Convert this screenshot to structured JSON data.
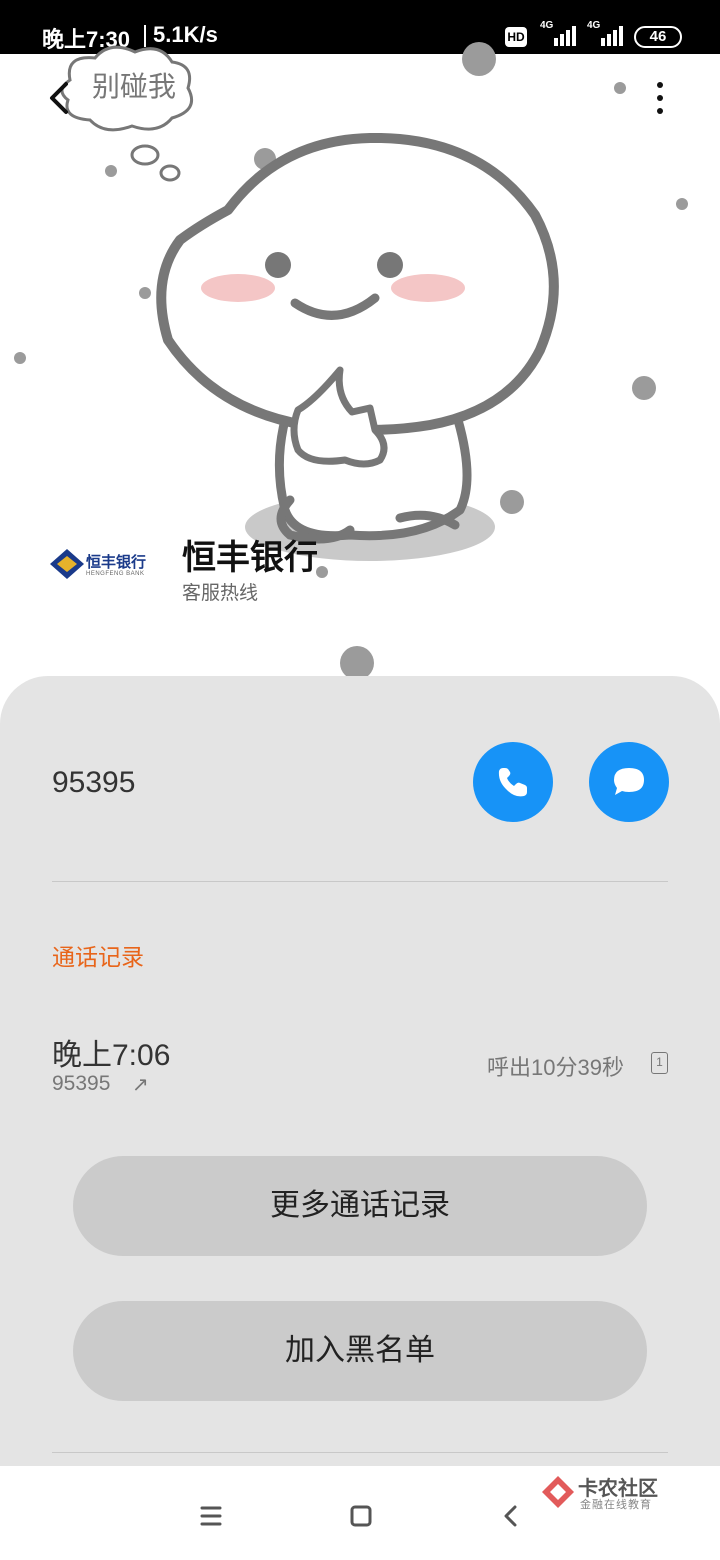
{
  "status_bar": {
    "time": "晚上7:30",
    "net_speed": "5.1K/s",
    "hd_label": "HD",
    "sim1_network": "4G",
    "sim2_network": "4G",
    "battery": "46"
  },
  "header": {
    "back_icon": "chevron-left-icon",
    "more_icon": "more-vertical-icon"
  },
  "avatar_sticker": {
    "bubble_text": "别碰我"
  },
  "contact": {
    "logo_text": "恒丰银行",
    "logo_subtext": "HENGFENG BANK",
    "name": "恒丰银行",
    "subtitle": "客服热线",
    "accent_color": "#1793f7"
  },
  "number_row": {
    "number": "95395",
    "call_icon": "phone-icon",
    "message_icon": "message-icon"
  },
  "call_log": {
    "section_title": "通话记录",
    "section_color": "#e8651a",
    "entries": [
      {
        "time": "晚上7:06",
        "number": "95395",
        "direction_icon": "outgoing-arrow-icon",
        "direction_glyph": "↗",
        "duration": "呼出10分39秒",
        "sim": "1"
      }
    ]
  },
  "actions": {
    "more_records": "更多通话记录",
    "blacklist": "加入黑名单"
  },
  "watermark": {
    "brand": "卡农社区",
    "slogan": "金融在线教育"
  },
  "nav_bar": {
    "menu_icon": "menu-icon",
    "home_icon": "home-square-icon",
    "back_icon": "back-triangle-icon"
  }
}
